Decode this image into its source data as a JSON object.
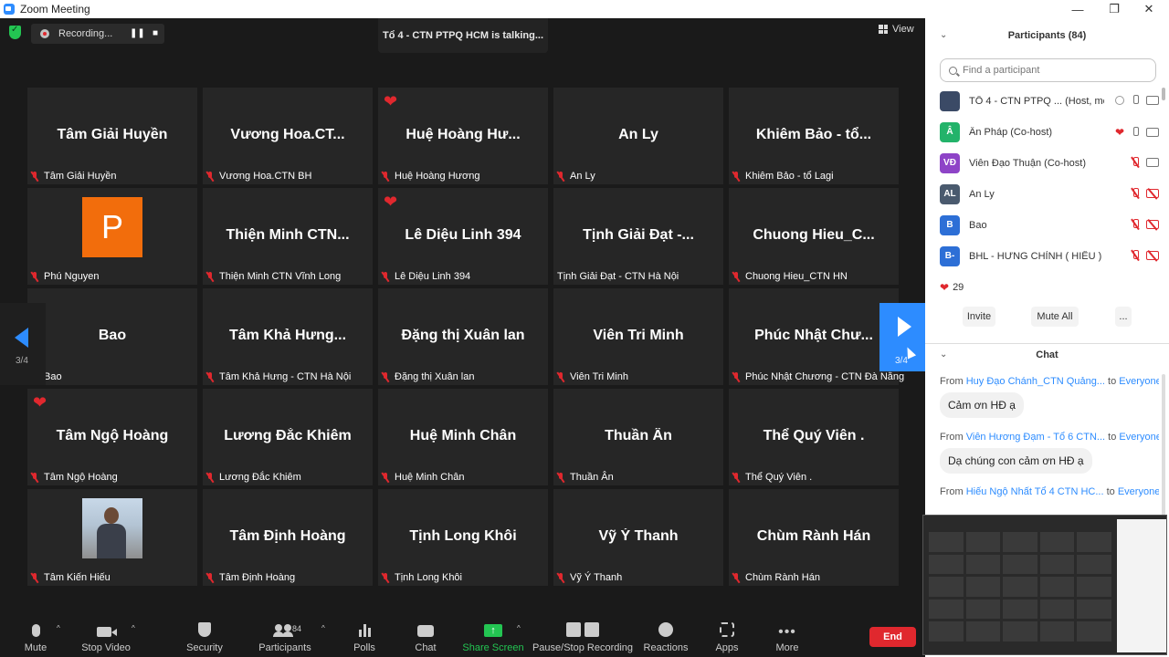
{
  "window": {
    "title": "Zoom Meeting",
    "minimize": "—",
    "maximize": "❐",
    "close": "✕"
  },
  "topbar": {
    "recording_label": "Recording...",
    "pause_glyph": "❚❚",
    "stop_glyph": "■",
    "talking": "Tổ 4 - CTN PTPQ HCM is talking...",
    "view_label": "View"
  },
  "tiles": [
    {
      "big": "Tâm Giải Huyền",
      "small": "Tâm Giải Huyền"
    },
    {
      "big": "Vương Hoa.CT...",
      "small": "Vương Hoa.CTN BH"
    },
    {
      "big": "Huệ Hoàng Hư...",
      "small": "Huệ Hoàng Hương"
    },
    {
      "big": "An Ly",
      "small": "An Ly"
    },
    {
      "big": "Khiêm Bảo - tổ...",
      "small": "Khiêm Bảo - tổ Lagi"
    },
    {
      "big": "",
      "small": "Phú Nguyen",
      "avatar": "P"
    },
    {
      "big": "Thiện Minh CTN...",
      "small": "Thiện Minh CTN Vĩnh Long"
    },
    {
      "big": "Lê Diệu Linh 394",
      "small": "Lê Diệu Linh 394"
    },
    {
      "big": "Tịnh Giải Đạt -...",
      "small": "Tịnh Giải Đạt - CTN Hà Nội"
    },
    {
      "big": "Chuong Hieu_C...",
      "small": "Chuong Hieu_CTN HN"
    },
    {
      "big": "Bao",
      "small": "Bao"
    },
    {
      "big": "Tâm Khả Hưng...",
      "small": "Tâm Khả Hưng - CTN Hà Nội"
    },
    {
      "big": "Đặng thị Xuân lan",
      "small": "Đặng thị Xuân lan"
    },
    {
      "big": "Viên Tri Minh",
      "small": "Viên Tri Minh"
    },
    {
      "big": "Phúc Nhật Chư...",
      "small": "Phúc Nhật Chương - CTN Đà Nẵng"
    },
    {
      "big": "Tâm Ngộ Hoàng",
      "small": "Tâm Ngộ Hoàng"
    },
    {
      "big": "Lương Đắc Khiêm",
      "small": "Lương Đắc Khiêm"
    },
    {
      "big": "Huệ Minh Chân",
      "small": "Huệ Minh Chân"
    },
    {
      "big": "Thuần Ân",
      "small": "Thuần Ân"
    },
    {
      "big": "Thể Quý Viên .",
      "small": "Thể Quý Viên ."
    },
    {
      "big": "",
      "small": "Tâm Kiến Hiếu",
      "photo": true
    },
    {
      "big": "Tâm Định Hoàng",
      "small": "Tâm Định Hoàng"
    },
    {
      "big": "Tịnh Long Khôi",
      "small": "Tịnh Long Khôi"
    },
    {
      "big": "Vỹ Ý Thanh",
      "small": "Vỹ Ý Thanh"
    },
    {
      "big": "Chùm Rành Hán",
      "small": "Chùm Rành Hán"
    }
  ],
  "pager": {
    "left": "3/4",
    "right": "3/4"
  },
  "toolbar": {
    "mute": "Mute",
    "stop_video": "Stop Video",
    "security": "Security",
    "participants": "Participants",
    "participants_count": "84",
    "polls": "Polls",
    "chat": "Chat",
    "share_screen": "Share Screen",
    "pause_stop_recording": "Pause/Stop Recording",
    "reactions": "Reactions",
    "apps": "Apps",
    "more": "More",
    "end": "End",
    "caret": "^"
  },
  "panel": {
    "participants_title": "Participants (84)",
    "search_placeholder": "Find a participant",
    "participants": [
      {
        "name": "TỔ 4 - CTN PTPQ ...",
        "role": "(Host, me)",
        "initials": "",
        "color": "#3b4a66"
      },
      {
        "name": "Ân Pháp (Co-host)",
        "initials": "Â",
        "color": "#23b36a"
      },
      {
        "name": "Viên Đạo Thuận (Co-host)",
        "initials": "VĐ",
        "color": "#8e44c7"
      },
      {
        "name": "An Ly",
        "initials": "AL",
        "color": "#4a5a6e"
      },
      {
        "name": "Bao",
        "initials": "B",
        "color": "#2d6fd6"
      },
      {
        "name": "BHL - HƯNG CHỈNH ( HIẾU )",
        "initials": "B-",
        "color": "#2d6fd6"
      }
    ],
    "reaction_count": "29",
    "invite": "Invite",
    "mute_all": "Mute All",
    "more": "...",
    "chat_title": "Chat",
    "chat": [
      {
        "from_word": "From",
        "sender": "Huy Đạo Chánh_CTN Quảng...",
        "to_word": "to",
        "to": "Everyone:",
        "message": "Cảm ơn HĐ ạ"
      },
      {
        "from_word": "From",
        "sender": "Viên Hương Đạm - Tổ 6 CTN...",
        "to_word": "to",
        "to": "Everyone:",
        "message": "Dạ chúng con cảm ơn HĐ ạ"
      },
      {
        "from_word": "From",
        "sender": "Hiếu Ngộ Nhất Tổ 4 CTN HC...",
        "to_word": "to",
        "to": "Everyone:",
        "message": ""
      }
    ]
  },
  "colors": {
    "accent": "#2d8cff",
    "end_red": "#e0282e",
    "share_green": "#23c552",
    "tile_bg": "#262626"
  }
}
